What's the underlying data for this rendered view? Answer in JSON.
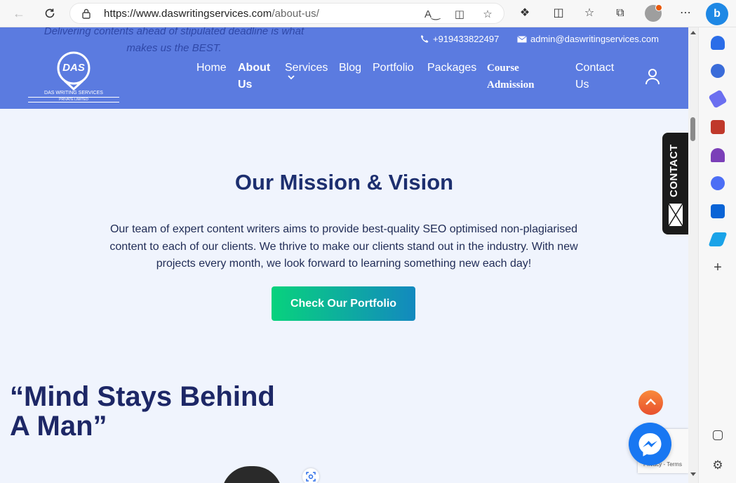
{
  "browser": {
    "url_host": "https://www.daswritingservices.com",
    "url_path": "/about-us/",
    "bing_label": "b"
  },
  "header": {
    "tagline": "Delivering contents ahead of stipulated deadline is what makes us the BEST.",
    "phone": "+919433822497",
    "email": "admin@daswritingservices.com",
    "logo_text": "DAS",
    "logo_caption": "DAS WRITING SERVICES",
    "logo_subcaption": "PRIVATE LIMITED",
    "menu": {
      "home": "Home",
      "about_line1": "About",
      "about_line2": "Us",
      "services": "Services",
      "blog": "Blog",
      "portfolio": "Portfolio",
      "packages": "Packages",
      "course_line1": "Course",
      "course_line2": "Admission",
      "contact_line1": "Contact",
      "contact_line2": "Us"
    }
  },
  "mission": {
    "title": "Our Mission & Vision",
    "text": "Our team of expert content writers aims to provide best-quality SEO optimised non-plagiarised content to each of our clients. We thrive to make our clients stand out in the industry. With new projects every month, we look forward to learning something new each day!",
    "button": "Check Our Portfolio"
  },
  "quote": {
    "text": "“Mind Stays Behind A Man”"
  },
  "widgets": {
    "contact_tab": "CONTACT",
    "recaptcha": "Privacy - Terms"
  },
  "colors": {
    "header_bg": "#5b7be0",
    "page_bg": "#f0f4fd",
    "title": "#1d2f6f",
    "button_start": "#08d27d",
    "button_end": "#1389bf"
  }
}
